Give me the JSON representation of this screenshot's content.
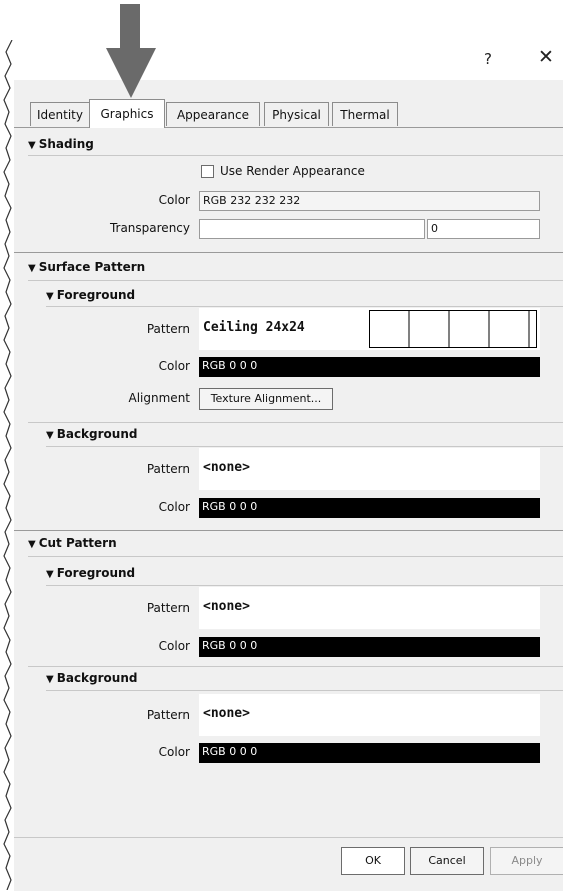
{
  "dialog": {
    "help_glyph": "?",
    "close_glyph": "✕"
  },
  "tabs": [
    {
      "label": "Identity",
      "active": false
    },
    {
      "label": "Graphics",
      "active": true
    },
    {
      "label": "Appearance",
      "active": false
    },
    {
      "label": "Physical",
      "active": false
    },
    {
      "label": "Thermal",
      "active": false
    }
  ],
  "shading": {
    "title": "Shading",
    "use_render_label": "Use Render Appearance",
    "color_label": "Color",
    "color_value": "RGB 232 232 232",
    "transparency_label": "Transparency",
    "transparency_value": "0"
  },
  "surface_pattern": {
    "title": "Surface Pattern",
    "foreground": {
      "title": "Foreground",
      "pattern_label": "Pattern",
      "pattern_value": "Ceiling 24x24",
      "color_label": "Color",
      "color_value": "RGB 0 0 0",
      "alignment_label": "Alignment",
      "alignment_button": "Texture Alignment..."
    },
    "background": {
      "title": "Background",
      "pattern_label": "Pattern",
      "pattern_value": "<none>",
      "color_label": "Color",
      "color_value": "RGB 0 0 0"
    }
  },
  "cut_pattern": {
    "title": "Cut Pattern",
    "foreground": {
      "title": "Foreground",
      "pattern_label": "Pattern",
      "pattern_value": "<none>",
      "color_label": "Color",
      "color_value": "RGB 0 0 0"
    },
    "background": {
      "title": "Background",
      "pattern_label": "Pattern",
      "pattern_value": "<none>",
      "color_label": "Color",
      "color_value": "RGB 0 0 0"
    }
  },
  "buttons": {
    "ok": "OK",
    "cancel": "Cancel",
    "apply": "Apply"
  },
  "colors": {
    "panel_bg": "#f0f0f0",
    "annotation_arrow": "#6a6a6a",
    "swatch_black": "#000000"
  }
}
